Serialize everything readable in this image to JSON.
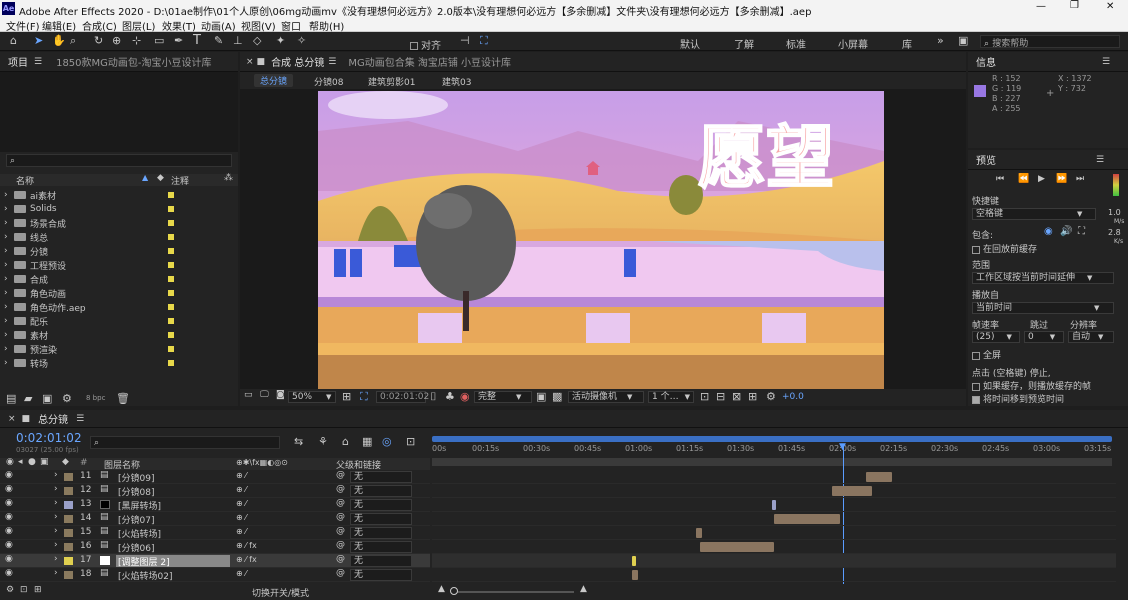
{
  "app": {
    "logo": "Ae",
    "title": "Adobe After Effects 2020 - D:\\01ae制作\\01个人原创\\06mg动画mv《没有理想何必远方》2.0版本\\没有理想何必远方【多余删减】文件夹\\没有理想何必远方【多余删减】.aep"
  },
  "menu": [
    "文件(F)",
    "编辑(E)",
    "合成(C)",
    "图层(L)",
    "效果(T)",
    "动画(A)",
    "视图(V)",
    "窗口",
    "帮助(H)"
  ],
  "toolbar": {
    "align_label": "对齐",
    "workspaces": [
      "默认",
      "了解",
      "标准",
      "小屏幕",
      "库"
    ],
    "search_placeholder": "搜索帮助"
  },
  "project": {
    "tab": "项目",
    "tab2": "1850款MG动画包-淘宝小豆设计库",
    "col_name": "名称",
    "col_note": "注释",
    "items": [
      "ai素材",
      "Solids",
      "场景合成",
      "线总",
      "分镜",
      "工程预设",
      "合成",
      "角色动画",
      "角色动作.aep",
      "配乐",
      "素材",
      "预渲染",
      "转场"
    ],
    "bpc": "8 bpc"
  },
  "comp": {
    "tab": "合成 总分镜",
    "tab2": "MG动画包合集 淘宝店铺 小豆设计库",
    "subtabs": [
      "总分镜",
      "分镜08",
      "建筑剪影01",
      "建筑03"
    ],
    "title_text": "愿望",
    "zoom": "50%",
    "timecode": "0:02:01:02",
    "quality": "完整",
    "camera": "活动摄像机",
    "views": "1 个…",
    "exposure": "+0.0"
  },
  "info": {
    "tab": "信息",
    "r": "R : 152",
    "g": "G : 119",
    "b": "B : 227",
    "a": "A : 255",
    "x": "X : 1372",
    "y": "Y : 732",
    "swatch": "#9877e3"
  },
  "preview": {
    "tab": "预览",
    "shortcut_label": "快捷键",
    "shortcut_value": "空格键",
    "include_label": "包含:",
    "cache_label": "在回放前缓存",
    "range_label": "范围",
    "range_value": "工作区域按当前时间延伸",
    "playfrom_label": "播放自",
    "playfrom_value": "当前时间",
    "fps_label": "帧速率",
    "skip_label": "跳过",
    "res_label": "分辨率",
    "fps_value": "(25)",
    "skip_value": "0",
    "res_value": "自动",
    "fullscreen": "全屏",
    "stop_label": "点击 (空格键) 停止,",
    "stop_opt1": "如果缓存，则播放缓存的帧",
    "stop_opt2": "将时间移到预览时间",
    "speed1": "1.0",
    "speed1u": "M/s",
    "speed2": "2.8",
    "speed2u": "K/s"
  },
  "timeline": {
    "tab": "总分镜",
    "timecode": "0:02:01:02",
    "sub": "03027 (25.00 fps)",
    "search_placeholder": "",
    "col_layer": "图层名称",
    "col_parent": "父级和链接",
    "ruler": [
      "00s",
      "00:15s",
      "00:30s",
      "00:45s",
      "01:00s",
      "01:15s",
      "01:30s",
      "01:45s",
      "02:00s",
      "02:15s",
      "02:30s",
      "02:45s",
      "03:00s",
      "03:15s"
    ],
    "layers": [
      {
        "num": "11",
        "name": "[分镜09]",
        "parent": "无",
        "color": "#8a7a5e"
      },
      {
        "num": "12",
        "name": "[分镜08]",
        "parent": "无",
        "color": "#8a7a5e"
      },
      {
        "num": "13",
        "name": "[黑屏转场]",
        "parent": "无",
        "color": "#9aa0c8"
      },
      {
        "num": "14",
        "name": "[分镜07]",
        "parent": "无",
        "color": "#8a7a5e"
      },
      {
        "num": "15",
        "name": "[火焰转场]",
        "parent": "无",
        "color": "#8a7a5e"
      },
      {
        "num": "16",
        "name": "[分镜06]",
        "parent": "无",
        "color": "#8a7a5e"
      },
      {
        "num": "17",
        "name": "[调整图层 2]",
        "parent": "无",
        "color": "#e0d050"
      },
      {
        "num": "18",
        "name": "[火焰转场02]",
        "parent": "无",
        "color": "#8a7a5e"
      }
    ],
    "footer": "切换开关/模式"
  }
}
